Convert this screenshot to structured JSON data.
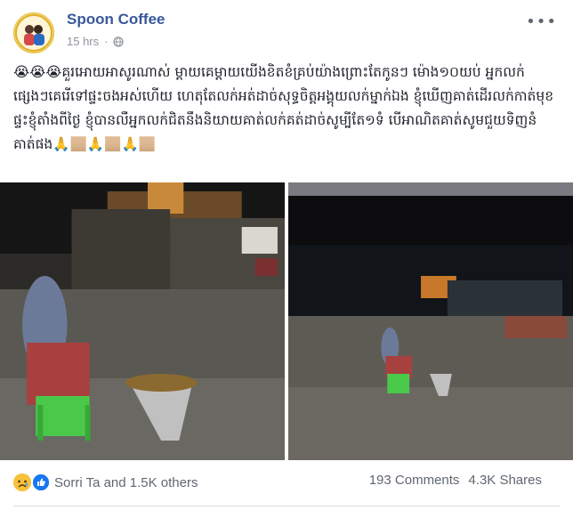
{
  "post": {
    "author": "Spoon Coffee",
    "timestamp": "15 hrs",
    "privacy_icon": "globe-icon",
    "more_icon": "more-icon",
    "text": "😭😭😭គួរអោយអាសូរណាស់ ម្ដាយគេម្ដាយយើងខិតខំគ្រប់យ៉ាងព្រោះតែកូនៗ ម៉ោង១០យប់ អ្នកលក់ផ្សេងៗគេរើទៅផ្ទះចងអស់ហើយ ហេតុតែលក់អត់ដាច់សុទ្ធចិត្តអង្គុយលក់ម្នាក់ឯង ខ្ញុំឃើញគាត់ដើរលក់កាត់មុខផ្ទះខ្ញុំតាំងពីថ្ងៃ ខ្ញុំបានលឺអ្នកលក់ជិតនឹងនិយាយគាត់លក់គត់ដាច់សូម្បីតែ១ទំ បើអាណិតគាត់សូមជួយទិញនំគាត់ផង🙏🏼🙏🏼🙏🏼"
  },
  "photos": [
    {
      "name": "photo-1"
    },
    {
      "name": "photo-2"
    }
  ],
  "footer": {
    "reactions_text": "Sorri Ta and 1.5K others",
    "comments": "193 Comments",
    "shares": "4.3K Shares"
  },
  "colors": {
    "author_link": "#385898",
    "meta_text": "#90949c",
    "body_text": "#1d2129",
    "footer_text": "#606770"
  }
}
